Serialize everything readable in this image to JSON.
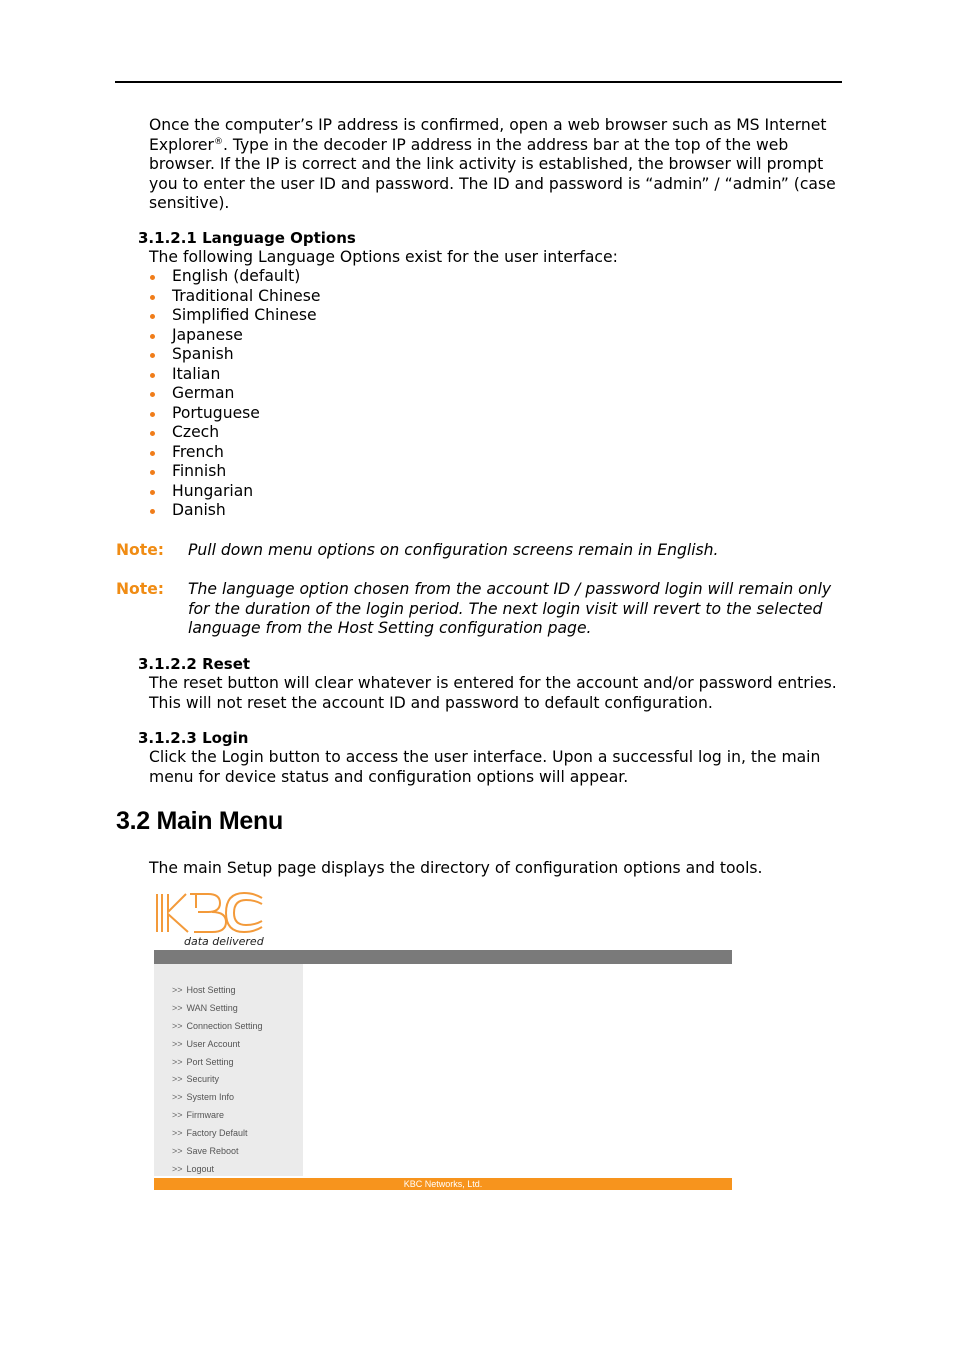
{
  "intro": {
    "text_before_sup": "Once the computer’s IP address is confirmed, open a web browser such as MS Internet Explorer",
    "sup": "®",
    "text_after_sup": ". Type in the decoder IP address in the address bar at the top of the web browser. If the IP is correct and the link activity is established, the browser will prompt you to enter the user ID and password. The ID and password is “admin” / “admin” (case sensitive)."
  },
  "language_options": {
    "heading": "3.1.2.1 Language Options",
    "lead": "The following Language Options exist for the user interface:",
    "items": [
      "English (default)",
      "Traditional Chinese",
      "Simplified Chinese",
      "Japanese",
      "Spanish",
      "Italian",
      "German",
      "Portuguese",
      "Czech",
      "French",
      "Finnish",
      "Hungarian",
      "Danish"
    ],
    "bullet_color": "#f07d1a"
  },
  "notes": [
    {
      "label": "Note:",
      "text": "Pull down menu options on configuration screens remain in English."
    },
    {
      "label": "Note:",
      "text": "The language option chosen from the account ID / password login will remain only for the duration of the login period. The next login visit will revert to the selected language from the Host Setting configuration page."
    }
  ],
  "reset": {
    "heading": "3.1.2.2 Reset",
    "text": "The reset button will clear whatever is entered for the account and/or password entries. This will not reset the account ID and password to default configuration."
  },
  "login": {
    "heading": "3.1.2.3 Login",
    "text": "Click the Login button to access the user interface. Upon a successful log in, the main menu for device status and configuration options will appear."
  },
  "main_menu": {
    "heading": "3.2 Main Menu",
    "text": "The main Setup page displays the directory of configuration options and tools."
  },
  "screenshot": {
    "logo_text": "KBC",
    "tagline": "data delivered",
    "menu_prefix": ">>",
    "menu_items": [
      "Host Setting",
      "WAN Setting",
      "Connection Setting",
      "User Account",
      "Port Setting",
      "Security",
      "System Info",
      "Firmware",
      "Factory Default",
      "Save Reboot",
      "Logout"
    ],
    "footer": "KBC Networks, Ltd.",
    "brand_color": "#f7941d"
  }
}
